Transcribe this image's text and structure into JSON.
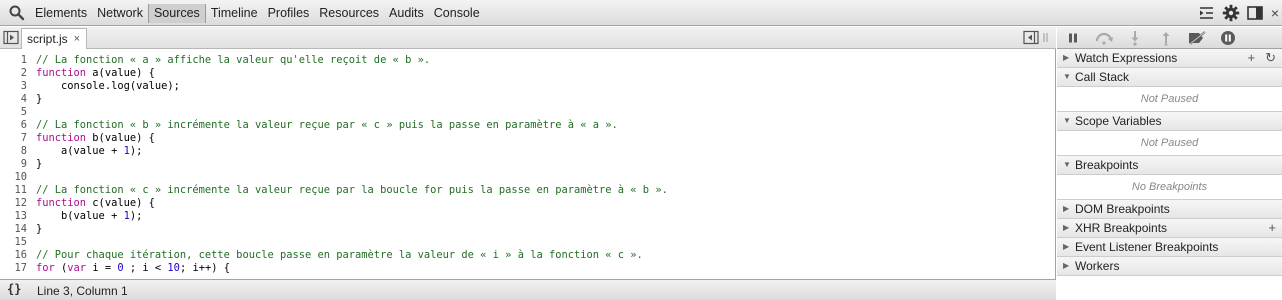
{
  "toolbar": {
    "search_icon": "magnifier-icon",
    "tabs": [
      {
        "label": "Elements"
      },
      {
        "label": "Network"
      },
      {
        "label": "Sources"
      },
      {
        "label": "Timeline"
      },
      {
        "label": "Profiles"
      },
      {
        "label": "Resources"
      },
      {
        "label": "Audits"
      },
      {
        "label": "Console"
      }
    ],
    "selected_tab": "Sources",
    "right_icons": [
      "drawer-toggle-icon",
      "settings-gear-icon",
      "dock-icon",
      "close-icon"
    ],
    "close_glyph": "×"
  },
  "editor": {
    "file_tab": {
      "name": "script.js",
      "close": "×"
    },
    "line_numbers": [
      "1",
      "2",
      "3",
      "4",
      "5",
      "6",
      "7",
      "8",
      "9",
      "10",
      "11",
      "12",
      "13",
      "14",
      "15",
      "16",
      "17"
    ],
    "lines": [
      [
        {
          "t": "com",
          "v": "// La fonction « a » affiche la valeur qu'elle reçoit de « b »."
        }
      ],
      [
        {
          "t": "kw",
          "v": "function"
        },
        {
          "t": "txt",
          "v": " a(value) {"
        }
      ],
      [
        {
          "t": "txt",
          "v": "    console.log(value);"
        }
      ],
      [
        {
          "t": "txt",
          "v": "}"
        }
      ],
      [],
      [
        {
          "t": "com",
          "v": "// La fonction « b » incrémente la valeur reçue par « c » puis la passe en paramètre à « a »."
        }
      ],
      [
        {
          "t": "kw",
          "v": "function"
        },
        {
          "t": "txt",
          "v": " b(value) {"
        }
      ],
      [
        {
          "t": "txt",
          "v": "    a(value + "
        },
        {
          "t": "num",
          "v": "1"
        },
        {
          "t": "txt",
          "v": ");"
        }
      ],
      [
        {
          "t": "txt",
          "v": "}"
        }
      ],
      [],
      [
        {
          "t": "com",
          "v": "// La fonction « c » incrémente la valeur reçue par la boucle for puis la passe en paramètre à « b »."
        }
      ],
      [
        {
          "t": "kw",
          "v": "function"
        },
        {
          "t": "txt",
          "v": " c(value) {"
        }
      ],
      [
        {
          "t": "txt",
          "v": "    b(value + "
        },
        {
          "t": "num",
          "v": "1"
        },
        {
          "t": "txt",
          "v": ");"
        }
      ],
      [
        {
          "t": "txt",
          "v": "}"
        }
      ],
      [],
      [
        {
          "t": "com",
          "v": "// Pour chaque itération, cette boucle passe en paramètre la valeur de « i » à la fonction « c »."
        }
      ],
      [
        {
          "t": "kw",
          "v": "for"
        },
        {
          "t": "txt",
          "v": " ("
        },
        {
          "t": "kw",
          "v": "var"
        },
        {
          "t": "txt",
          "v": " i = "
        },
        {
          "t": "num",
          "v": "0"
        },
        {
          "t": "txt",
          "v": " ; i < "
        },
        {
          "t": "num",
          "v": "10"
        },
        {
          "t": "txt",
          "v": "; i++) {"
        }
      ]
    ],
    "status": {
      "pretty_print": "{}",
      "cursor": "Line 3, Column 1"
    }
  },
  "sidebar": {
    "debug_icons": [
      "pause-icon",
      "step-over-icon",
      "step-into-icon",
      "step-out-icon",
      "deactivate-breakpoints-icon",
      "pause-on-exceptions-icon"
    ],
    "panes": [
      {
        "name": "watch-expressions",
        "title": "Watch Expressions",
        "expanded": false,
        "actions": [
          "+",
          "↻"
        ]
      },
      {
        "name": "call-stack",
        "title": "Call Stack",
        "expanded": true,
        "body": "Not Paused"
      },
      {
        "name": "scope-variables",
        "title": "Scope Variables",
        "expanded": true,
        "body": "Not Paused"
      },
      {
        "name": "breakpoints",
        "title": "Breakpoints",
        "expanded": true,
        "body": "No Breakpoints"
      },
      {
        "name": "dom-breakpoints",
        "title": "DOM Breakpoints",
        "expanded": false
      },
      {
        "name": "xhr-breakpoints",
        "title": "XHR Breakpoints",
        "expanded": false,
        "actions": [
          "+"
        ]
      },
      {
        "name": "event-listener-breakpoints",
        "title": "Event Listener Breakpoints",
        "expanded": false
      },
      {
        "name": "workers",
        "title": "Workers",
        "expanded": false
      }
    ]
  },
  "colors": {
    "comment": "#236e25",
    "keyword": "#aa0d91",
    "number": "#1c00cf",
    "debug_icon": "#5a5a5a"
  }
}
